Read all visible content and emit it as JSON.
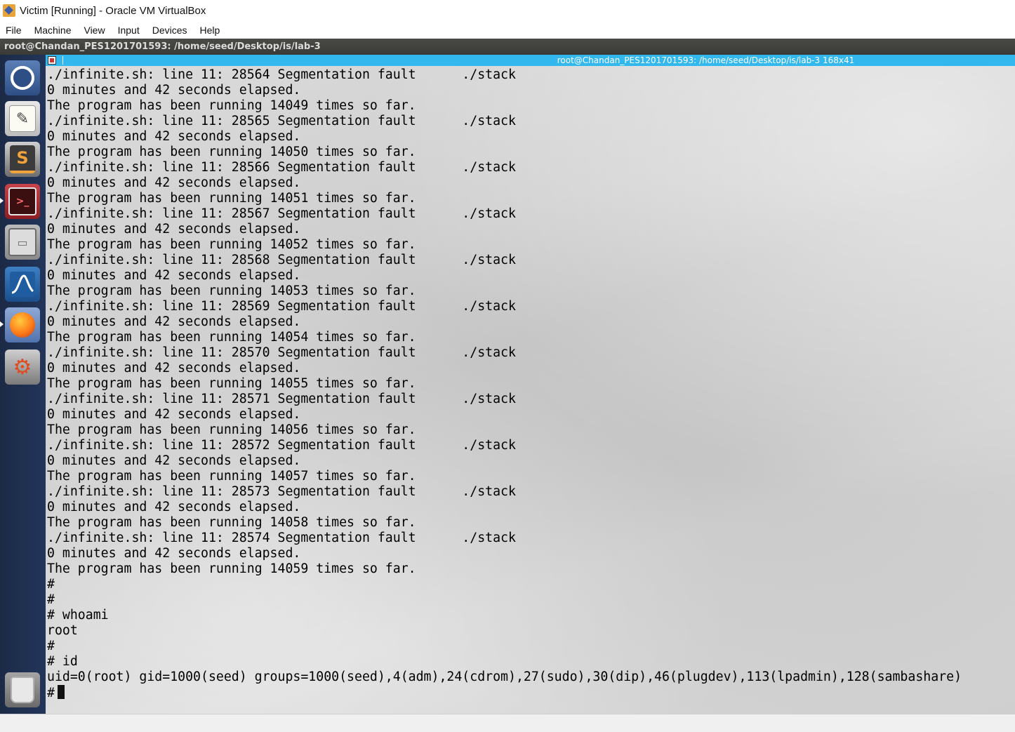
{
  "window": {
    "title": "Victim [Running] - Oracle VM VirtualBox"
  },
  "menubar": {
    "items": [
      "File",
      "Machine",
      "View",
      "Input",
      "Devices",
      "Help"
    ]
  },
  "guest_panel": {
    "title": "root@Chandan_PES1201701593: /home/seed/Desktop/is/lab-3"
  },
  "terminal": {
    "title": "root@Chandan_PES1201701593: /home/seed/Desktop/is/lab-3 168x41",
    "lines": [
      "./infinite.sh: line 11: 28564 Segmentation fault      ./stack",
      "0 minutes and 42 seconds elapsed.",
      "The program has been running 14049 times so far.",
      "./infinite.sh: line 11: 28565 Segmentation fault      ./stack",
      "0 minutes and 42 seconds elapsed.",
      "The program has been running 14050 times so far.",
      "./infinite.sh: line 11: 28566 Segmentation fault      ./stack",
      "0 minutes and 42 seconds elapsed.",
      "The program has been running 14051 times so far.",
      "./infinite.sh: line 11: 28567 Segmentation fault      ./stack",
      "0 minutes and 42 seconds elapsed.",
      "The program has been running 14052 times so far.",
      "./infinite.sh: line 11: 28568 Segmentation fault      ./stack",
      "0 minutes and 42 seconds elapsed.",
      "The program has been running 14053 times so far.",
      "./infinite.sh: line 11: 28569 Segmentation fault      ./stack",
      "0 minutes and 42 seconds elapsed.",
      "The program has been running 14054 times so far.",
      "./infinite.sh: line 11: 28570 Segmentation fault      ./stack",
      "0 minutes and 42 seconds elapsed.",
      "The program has been running 14055 times so far.",
      "./infinite.sh: line 11: 28571 Segmentation fault      ./stack",
      "0 minutes and 42 seconds elapsed.",
      "The program has been running 14056 times so far.",
      "./infinite.sh: line 11: 28572 Segmentation fault      ./stack",
      "0 minutes and 42 seconds elapsed.",
      "The program has been running 14057 times so far.",
      "./infinite.sh: line 11: 28573 Segmentation fault      ./stack",
      "0 minutes and 42 seconds elapsed.",
      "The program has been running 14058 times so far.",
      "./infinite.sh: line 11: 28574 Segmentation fault      ./stack",
      "0 minutes and 42 seconds elapsed.",
      "The program has been running 14059 times so far.",
      "#",
      "#",
      "# whoami",
      "root",
      "#",
      "# id",
      "uid=0(root) gid=1000(seed) groups=1000(seed),4(adm),24(cdrom),27(sudo),30(dip),46(plugdev),113(lpadmin),128(sambashare)"
    ],
    "prompt": "#"
  },
  "launcher": {
    "items": [
      {
        "icon": "ubuntu-dash-icon"
      },
      {
        "icon": "text-editor-icon",
        "glyph": "✎"
      },
      {
        "icon": "sublime-text-icon",
        "glyph": "S"
      },
      {
        "icon": "terminal-icon",
        "glyph": ">_"
      },
      {
        "icon": "file-manager-icon",
        "glyph": "▭"
      },
      {
        "icon": "wireshark-icon"
      },
      {
        "icon": "firefox-icon"
      },
      {
        "icon": "system-settings-icon",
        "glyph": "⚙"
      },
      {
        "icon": "trash-icon"
      }
    ]
  }
}
